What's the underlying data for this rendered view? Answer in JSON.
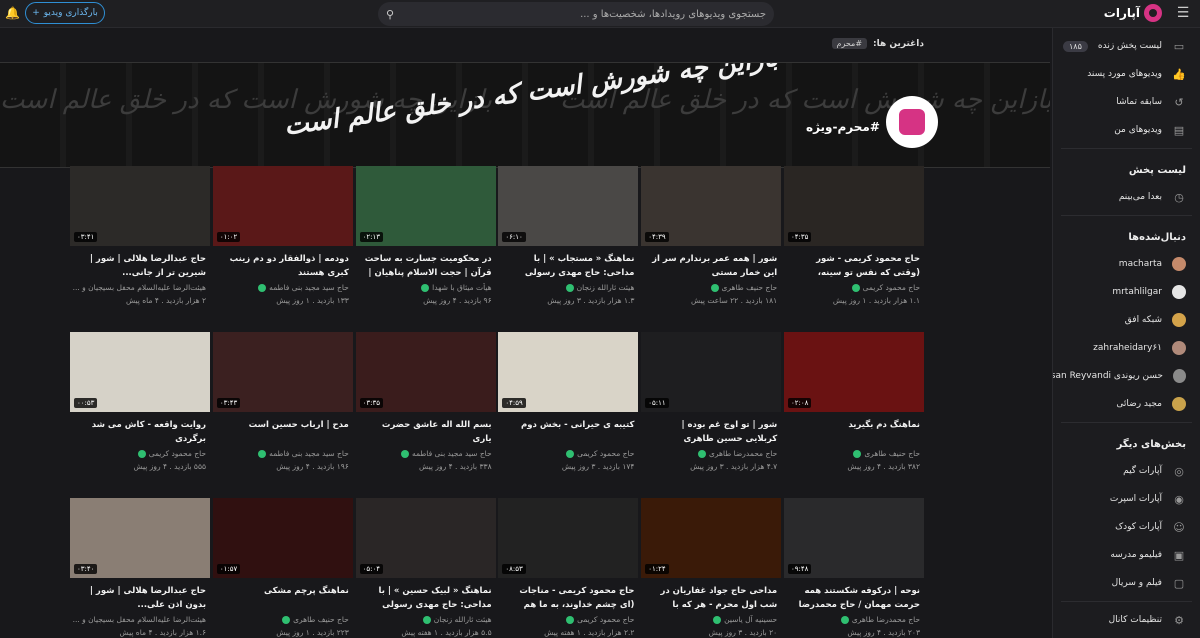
{
  "header": {
    "logo_text": "آپارات",
    "search_placeholder": "جستجوی ویدیوهای رویدادها، شخصیت‌ها و ...",
    "upload_label": "بارگذاری ویدیو"
  },
  "sidebar": {
    "top_items": [
      {
        "label": "لیست پخش زنده",
        "badge": "۱۸۵",
        "icon": "live-icon"
      },
      {
        "label": "ویدیوهای مورد پسند",
        "icon": "thumbs-up-icon"
      },
      {
        "label": "سابقه تماشا",
        "icon": "history-icon"
      },
      {
        "label": "ویدیوهای من",
        "icon": "my-videos-icon"
      }
    ],
    "playlist_title": "لیست پخش",
    "playlist_items": [
      {
        "label": "بعدا می‌بینم",
        "icon": "clock-icon"
      }
    ],
    "following_title": "دنبال‌شده‌ها",
    "following": [
      {
        "label": "macharta",
        "color": "#c58a6b"
      },
      {
        "label": "mrtahlilgar",
        "color": "#e5e5e5"
      },
      {
        "label": "شبکه افق",
        "color": "#d4a34a"
      },
      {
        "label": "zahraheidary۶۱",
        "color": "#b08a7a"
      },
      {
        "label": "حسن ریوندی Hasan Reyvandi",
        "color": "#8a8a8a"
      },
      {
        "label": "مجید رضائی",
        "color": "#c9a24b"
      }
    ],
    "other_title": "بخش‌های دیگر",
    "other": [
      {
        "label": "آپارات گیم",
        "icon": "game-icon"
      },
      {
        "label": "آپارات اسپرت",
        "icon": "sport-icon"
      },
      {
        "label": "آپارات کودک",
        "icon": "kids-icon"
      },
      {
        "label": "فیلیمو مدرسه",
        "icon": "school-icon"
      },
      {
        "label": "فیلم و سریال",
        "icon": "film-icon"
      }
    ],
    "settings_label": "تنظیمات کانال"
  },
  "page": {
    "tags_label": "داغترین ها:",
    "tag": "#محرم",
    "channel_name": "#محرم-ویژه",
    "banner_text": "بازاین چه شورش است که در خلق عالم است"
  },
  "videos": [
    {
      "title": "حاج محمود کریمی - شور (وقتی که نفس تو سینه، زندونه)",
      "channel": "حاج محمود کریمی",
      "views": "۱.۱ هزار بازدید",
      "time": "۱ روز پیش",
      "duration": "۰۴:۳۵",
      "bg": "#2a2623"
    },
    {
      "title": "شور | همه عمر برندارم سر از این خمار مستی",
      "channel": "حاج حنیف طاهری",
      "views": "۱۸۱ بازدید",
      "time": "۲۲ ساعت پیش",
      "duration": "۰۴:۳۹",
      "bg": "#3a3430"
    },
    {
      "title": "نماهنگ « مستجاب » | با مداحی: حاج مهدی رسولی",
      "channel": "هیئت ثارالله زنجان",
      "views": "۱.۳ هزار بازدید",
      "time": "۳ روز پیش",
      "duration": "۰۶:۱۰",
      "bg": "#4a4846"
    },
    {
      "title": "در محکومیت جسارت به ساحت قرآن | حجت الاسلام پناهیان | شب",
      "channel": "هیأت میثاق با شهدا",
      "views": "۹۶ بازدید",
      "time": "۴ روز پیش",
      "duration": "۰۲:۱۳",
      "bg": "#2f5a3a"
    },
    {
      "title": "دودمه | ذوالفقار دو دم زینب کبری هستند",
      "channel": "حاج سید مجید بنی فاطمه",
      "views": "۱۳۳ بازدید",
      "time": "۱ روز پیش",
      "duration": "۰۱:۰۲",
      "bg": "#5a1818"
    },
    {
      "title": "حاج عبدالرضا هلالی | شور | شیرین تر از جانی...",
      "channel": "هیئت‌الرضا علیه‌السلام محفل بسیجیان و ...",
      "views": "۲ هزار بازدید",
      "time": "۴ ماه پیش",
      "duration": "۰۳:۴۱",
      "bg": "#2c2a28"
    },
    {
      "title": "نماهنگ دم بگیرید",
      "channel": "حاج حنیف طاهری",
      "views": "۳۸۲ بازدید",
      "time": "۴ روز پیش",
      "duration": "۰۲:۰۸",
      "bg": "#6a1212"
    },
    {
      "title": "شور | تو اوج غم بوده | کربلایی حسین طاهری",
      "channel": "حاج محمدرضا طاهری",
      "views": "۴.۷ هزار بازدید",
      "time": "۳ روز پیش",
      "duration": "۰۵:۱۱",
      "bg": "#1e1e20"
    },
    {
      "title": "کتیبه ی حیرانی - بخش دوم",
      "channel": "حاج محمود کریمی",
      "views": "۱۷۴ بازدید",
      "time": "۳ روز پیش",
      "duration": "۰۴:۵۹",
      "bg": "#d9d4c8"
    },
    {
      "title": "بسم الله اله عاشق حضرت یاری",
      "channel": "حاج سید مجید بنی فاطمه",
      "views": "۳۳۸ بازدید",
      "time": "۴ روز پیش",
      "duration": "۰۳:۳۵",
      "bg": "#3a1c1c"
    },
    {
      "title": "مدح | ارباب حسین است",
      "channel": "حاج سید مجید بنی فاطمه",
      "views": "۱۹۶ بازدید",
      "time": "۴ روز پیش",
      "duration": "۰۳:۴۳",
      "bg": "#3b2020"
    },
    {
      "title": "روایت واقعه - کاش می شد برگردی",
      "channel": "حاج محمود کریمی",
      "views": "۵۵۵ بازدید",
      "time": "۴ روز پیش",
      "duration": "۰۰:۵۳",
      "bg": "#d6d2c8"
    },
    {
      "title": "نوحه | درکوفه شکستند همه حرمت مهمان / حاج محمدرضا طاهری",
      "channel": "حاج محمدرضا طاهری",
      "views": "۲۰۳ بازدید",
      "time": "۴ روز پیش",
      "duration": "۰۹:۴۸",
      "bg": "#2a2a2c"
    },
    {
      "title": "مداحی حاج جواد غفاریان در شب اول محرم - هر که با خاک...",
      "channel": "حسینیه آل یاسین",
      "views": "۲۰ بازدید",
      "time": "۳ روز پیش",
      "duration": "۰۱:۲۴",
      "bg": "#3a1a08"
    },
    {
      "title": "حاج محمود کریمی - مناجات (ای چشم خداوند، به ما هم نظری کن)",
      "channel": "حاج محمود کریمی",
      "views": "۲.۲ هزار بازدید",
      "time": "۱ هفته پیش",
      "duration": "۰۸:۵۳",
      "bg": "#222"
    },
    {
      "title": "نماهنگ « لبیک حسین » | با مداحی: حاج مهدی رسولی",
      "channel": "هیئت ثارالله زنجان",
      "views": "۵.۵ هزار بازدید",
      "time": "۱ هفته پیش",
      "duration": "۰۵:۰۴",
      "bg": "#2a2626"
    },
    {
      "title": "نماهنگ پرچم مشکی",
      "channel": "حاج حنیف طاهری",
      "views": "۲۲۳ بازدید",
      "time": "۱ روز پیش",
      "duration": "۰۱:۵۷",
      "bg": "#301010"
    },
    {
      "title": "حاج عبدالرضا هلالی | شور | بدون اذن علی...",
      "channel": "هیئت‌الرضا علیه‌السلام محفل بسیجیان و ...",
      "views": "۱.۶ هزار بازدید",
      "time": "۴ ماه پیش",
      "duration": "۰۳:۴۰",
      "bg": "#8a7e74"
    }
  ]
}
